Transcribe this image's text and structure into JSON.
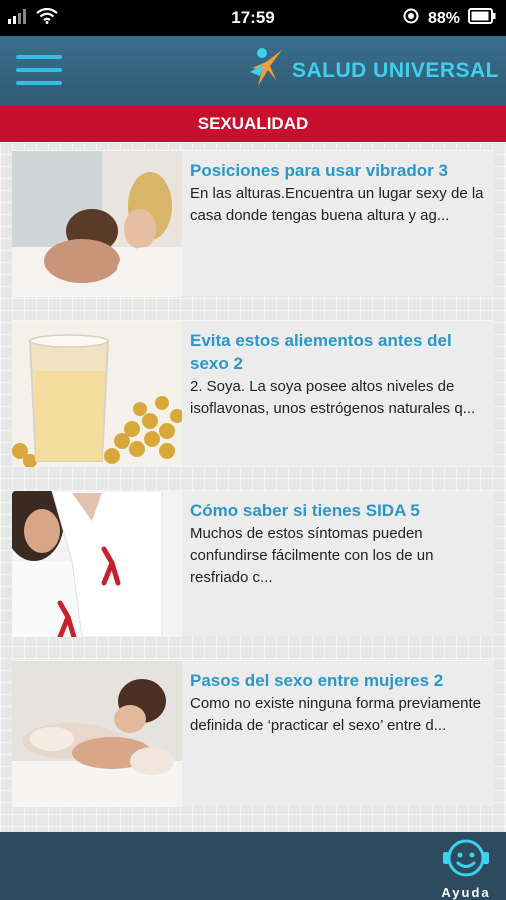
{
  "status_bar": {
    "time": "17:59",
    "battery": "88%"
  },
  "header": {
    "menu_icon": "hamburger-menu-icon",
    "brand_name": "SALUD UNIVERSAL"
  },
  "section": {
    "title": "SEXUALIDAD"
  },
  "articles": [
    {
      "title": "Posiciones para usar vibrador 3",
      "excerpt": "En las alturas.Encuentra un lugar sexy de la casa donde tengas buena altura y ag..."
    },
    {
      "title": "Evita estos aliementos antes del sexo 2",
      "excerpt": "2. Soya. La soya posee altos niveles de isoflavonas, unos estrógenos naturales q..."
    },
    {
      "title": "Cómo saber si tienes SIDA 5",
      "excerpt": "Muchos de estos síntomas pueden confundirse fácilmente con los de un resfriado c..."
    },
    {
      "title": "Pasos del sexo entre mujeres 2",
      "excerpt": "Como no existe ninguna forma previamente definida de ‘practicar el sexo’ entre d..."
    }
  ],
  "footer": {
    "help_label": "Ayuda",
    "help_icon": "smiley-headset-icon"
  },
  "colors": {
    "header": "#2f5b75",
    "accent_blue": "#2fc0e3",
    "section_red": "#c8102e",
    "title_blue": "#2b97c7"
  }
}
